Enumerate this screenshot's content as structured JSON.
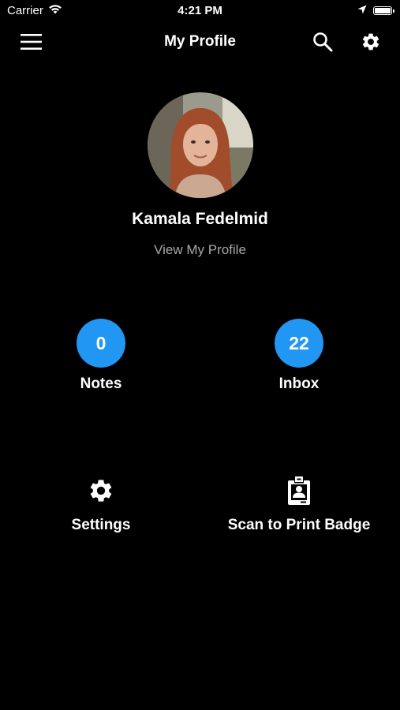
{
  "status_bar": {
    "carrier": "Carrier",
    "time": "4:21 PM"
  },
  "nav": {
    "title": "My Profile",
    "icons": [
      "hamburger-menu-icon",
      "search-icon",
      "gear-icon"
    ]
  },
  "profile": {
    "name": "Kamala Fedelmid",
    "view_profile_label": "View My Profile"
  },
  "counters": [
    {
      "count": "0",
      "label": "Notes"
    },
    {
      "count": "22",
      "label": "Inbox"
    }
  ],
  "actions": [
    {
      "label": "Settings",
      "icon": "gear-icon"
    },
    {
      "label": "Scan to Print Badge",
      "icon": "badge-icon"
    }
  ],
  "colors": {
    "background": "#000000",
    "accent": "#2196f3",
    "muted_text": "#a8a8a8"
  }
}
